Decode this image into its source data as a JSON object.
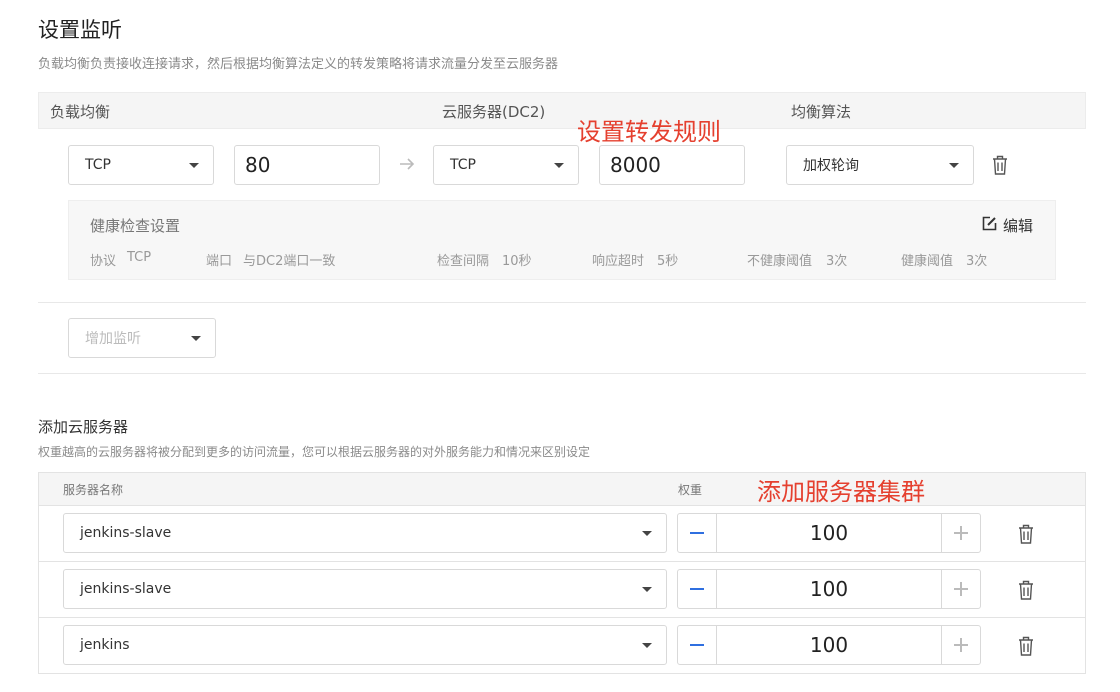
{
  "page": {
    "title": "设置监听",
    "subtitle": "负载均衡负责接收连接请求，然后根据均衡算法定义的转发策略将请求流量分发至云服务器"
  },
  "listener_header": {
    "lb_label": "负载均衡",
    "server_label": "云服务器(DC2)",
    "algo_label": "均衡算法"
  },
  "annotations": {
    "forward_rule": "设置转发规则",
    "add_cluster": "添加服务器集群"
  },
  "listener": {
    "lb_protocol": "TCP",
    "lb_port": "80",
    "arrow_icon": "arrow-right-icon",
    "server_protocol": "TCP",
    "server_port": "8000",
    "algorithm": "加权轮询"
  },
  "health_check": {
    "title": "健康检查设置",
    "edit_label": "编辑",
    "protocol_label": "协议",
    "protocol_value": "TCP",
    "port_label": "端口",
    "port_value": "与DC2端口一致",
    "interval_label": "检查间隔",
    "interval_value": "10秒",
    "timeout_label": "响应超时",
    "timeout_value": "5秒",
    "unhealthy_label": "不健康阈值",
    "unhealthy_value": "3次",
    "healthy_label": "健康阈值",
    "healthy_value": "3次"
  },
  "add_listener": {
    "placeholder": "增加监听"
  },
  "servers_section": {
    "title": "添加云服务器",
    "subtitle": "权重越高的云服务器将被分配到更多的访问流量，您可以根据云服务器的对外服务能力和情况来区别设定",
    "col_name": "服务器名称",
    "col_weight": "权重",
    "rows": [
      {
        "name": "jenkins-slave",
        "weight": "100"
      },
      {
        "name": "jenkins-slave",
        "weight": "100"
      },
      {
        "name": "jenkins",
        "weight": "100"
      }
    ]
  },
  "colors": {
    "annotation": "#e5402f",
    "stepper_minus": "#2f6fe0"
  }
}
